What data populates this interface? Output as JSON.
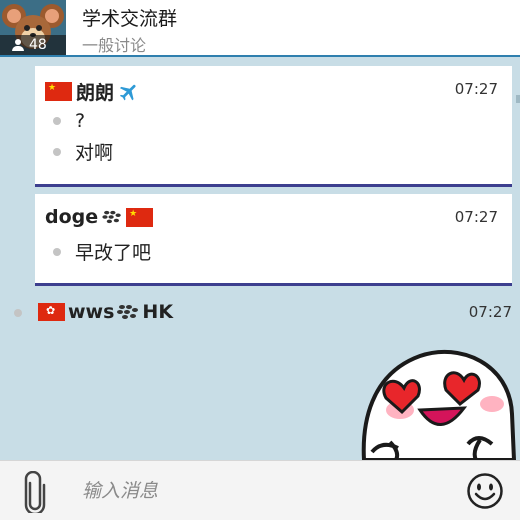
{
  "header": {
    "title": "学术交流群",
    "subtitle": "一般讨论",
    "member_count": "48"
  },
  "messages": [
    {
      "sender": "朗朗",
      "time": "07:27",
      "lines": [
        "?",
        "对啊"
      ]
    },
    {
      "sender": "doge",
      "time": "07:27",
      "lines": [
        "早改了吧"
      ]
    },
    {
      "sender": "wws",
      "sender_suffix": "HK",
      "time": "07:27"
    }
  ],
  "composer": {
    "placeholder": "输入消息"
  },
  "colors": {
    "header_rule": "#2f7fae",
    "card_rule": "#3d3f8f",
    "chat_background": "#c8dde6"
  },
  "icons": [
    "member-icon",
    "airplane-icon",
    "bbm-icon",
    "china-flag-icon",
    "hong-kong-flag-icon",
    "attachment-clip-icon",
    "smiley-icon",
    "heart-eyes-sticker"
  ]
}
